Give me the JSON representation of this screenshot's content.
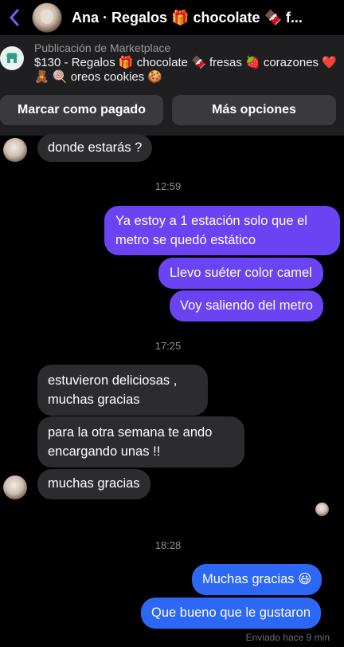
{
  "header": {
    "title": "Ana · Regalos 🎁 chocolate 🍫 f...",
    "back_icon": "chevron-left-icon",
    "accent_color": "#6a44f2"
  },
  "marketplace": {
    "label": "Publicación de Marketplace",
    "description": "$130 - Regalos 🎁 chocolate 🍫 fresas 🍓 corazones ❤️ 🧸 🍭 oreos cookies 🍪",
    "icon": "storefront-icon",
    "mark_paid_label": "Marcar como pagado",
    "more_options_label": "Más opciones"
  },
  "messages": {
    "m1": "donde estarás ?",
    "t1": "12:59",
    "m2": "Ya estoy a 1 estación solo que el metro se quedó estático",
    "m3": "Llevo suéter color camel",
    "m4": "Voy saliendo del metro",
    "t2": "17:25",
    "m5": "estuvieron deliciosas , muchas gracias",
    "m6": "para la otra semana te ando encargando unas !!",
    "m7": "muchas gracias",
    "t3": "18:28",
    "m8": "Muchas gracias 😃",
    "m9": "Que bueno que le gustaron",
    "status": "Enviado hace 9 min"
  },
  "colors": {
    "incoming": "#2c2c2e",
    "outgoing_purple": "#6a44f2",
    "outgoing_blue": "#2c67f6"
  }
}
